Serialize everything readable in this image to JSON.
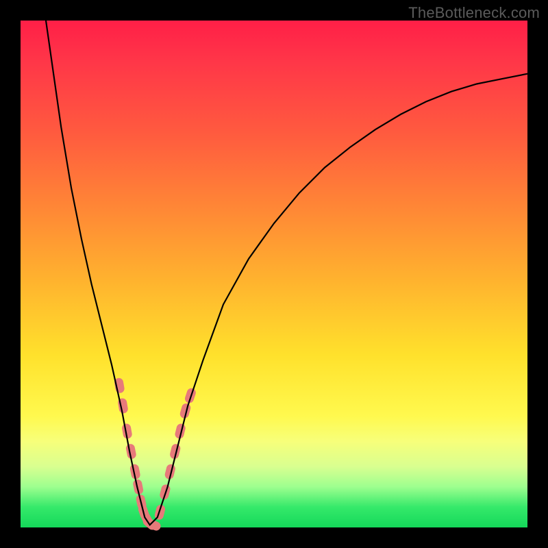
{
  "watermark": "TheBottleneck.com",
  "chart_data": {
    "type": "line",
    "title": "",
    "xlabel": "",
    "ylabel": "",
    "xlim": [
      0,
      100
    ],
    "ylim": [
      0,
      100
    ],
    "grid": false,
    "legend": false,
    "background_gradient": {
      "direction": "vertical",
      "stops": [
        {
          "pos": 0,
          "color": "#ff1f47"
        },
        {
          "pos": 22,
          "color": "#ff5a3f"
        },
        {
          "pos": 52,
          "color": "#ffb52e"
        },
        {
          "pos": 78,
          "color": "#fff94e"
        },
        {
          "pos": 92,
          "color": "#9dff8f"
        },
        {
          "pos": 100,
          "color": "#14d85a"
        }
      ]
    },
    "series": [
      {
        "name": "curve",
        "stroke": "#000000",
        "x": [
          5,
          6,
          7,
          8,
          10,
          12,
          14,
          16,
          18,
          20,
          21.5,
          23,
          24.5,
          25.5,
          27,
          29,
          31,
          33,
          36,
          40,
          45,
          50,
          55,
          60,
          65,
          70,
          75,
          80,
          85,
          90,
          95,
          100
        ],
        "y": [
          100,
          93,
          86,
          79,
          67,
          57,
          48,
          40,
          32,
          23,
          15,
          8,
          2,
          0.5,
          2,
          8,
          16,
          24,
          33,
          44,
          53,
          60,
          66,
          71,
          75,
          78.5,
          81.5,
          84,
          86,
          87.5,
          88.5,
          89.5
        ]
      }
    ],
    "annotations": {
      "left_cluster": {
        "color": "#e77a7a",
        "points": [
          {
            "x": 19.5,
            "y": 28
          },
          {
            "x": 20.2,
            "y": 24
          },
          {
            "x": 21.0,
            "y": 19
          },
          {
            "x": 21.8,
            "y": 15
          },
          {
            "x": 22.6,
            "y": 11
          },
          {
            "x": 23.2,
            "y": 8
          },
          {
            "x": 23.8,
            "y": 5
          },
          {
            "x": 24.3,
            "y": 3
          },
          {
            "x": 25.0,
            "y": 1.5
          },
          {
            "x": 25.5,
            "y": 0.8
          },
          {
            "x": 26.2,
            "y": 0.5
          }
        ]
      },
      "right_cluster": {
        "color": "#e77a7a",
        "points": [
          {
            "x": 27.5,
            "y": 3
          },
          {
            "x": 28.5,
            "y": 7
          },
          {
            "x": 29.5,
            "y": 11
          },
          {
            "x": 30.5,
            "y": 15
          },
          {
            "x": 31.5,
            "y": 19
          },
          {
            "x": 32.5,
            "y": 23
          },
          {
            "x": 33.5,
            "y": 26
          }
        ]
      }
    }
  }
}
